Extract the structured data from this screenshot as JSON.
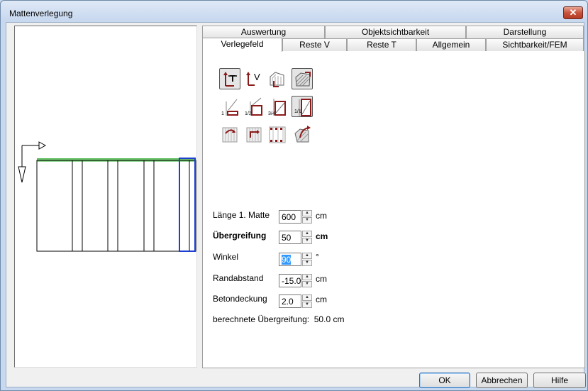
{
  "window": {
    "title": "Mattenverlegung",
    "close_label": "✕"
  },
  "tabs": {
    "row1": [
      "Auswertung",
      "Objektsichtbarkeit",
      "Darstellung"
    ],
    "row2": [
      "Verlegefeld",
      "Reste V",
      "Reste T",
      "Allgemein",
      "Sichtbarkeit/FEM"
    ],
    "active": "Verlegefeld"
  },
  "toolbar_icons": [
    "mat-direction-t-icon",
    "mat-direction-v-icon",
    "polygon-area-icon",
    "hatched-area-icon",
    "width-1-icon",
    "width-1-2-icon",
    "width-3-4-icon",
    "width-1-1-icon",
    "rest-rotate-icon",
    "rest-flip-icon",
    "mat-grid-icon",
    "area-rotate-icon"
  ],
  "form": {
    "laenge": {
      "label": "Länge 1. Matte",
      "value": "600",
      "unit": "cm"
    },
    "uebergreifung": {
      "label": "Übergreifung",
      "value": "50",
      "unit": "cm"
    },
    "winkel": {
      "label": "Winkel",
      "value": "90",
      "unit": "°"
    },
    "randabstand": {
      "label": "Randabstand",
      "value": "-15.0",
      "unit": "cm"
    },
    "betondeckung": {
      "label": "Betondeckung",
      "value": "2.0",
      "unit": "cm"
    },
    "computed": "berechnete Übergreifung:  50.0 cm"
  },
  "buttons": {
    "ok": "OK",
    "cancel": "Abbrechen",
    "help": "Hilfe"
  },
  "spin": {
    "up": "▲",
    "down": "▼"
  },
  "colors": {
    "accent_blue": "#1f3fd0",
    "overlap_green": "#22aa22",
    "icon_red": "#8b1a1a"
  }
}
